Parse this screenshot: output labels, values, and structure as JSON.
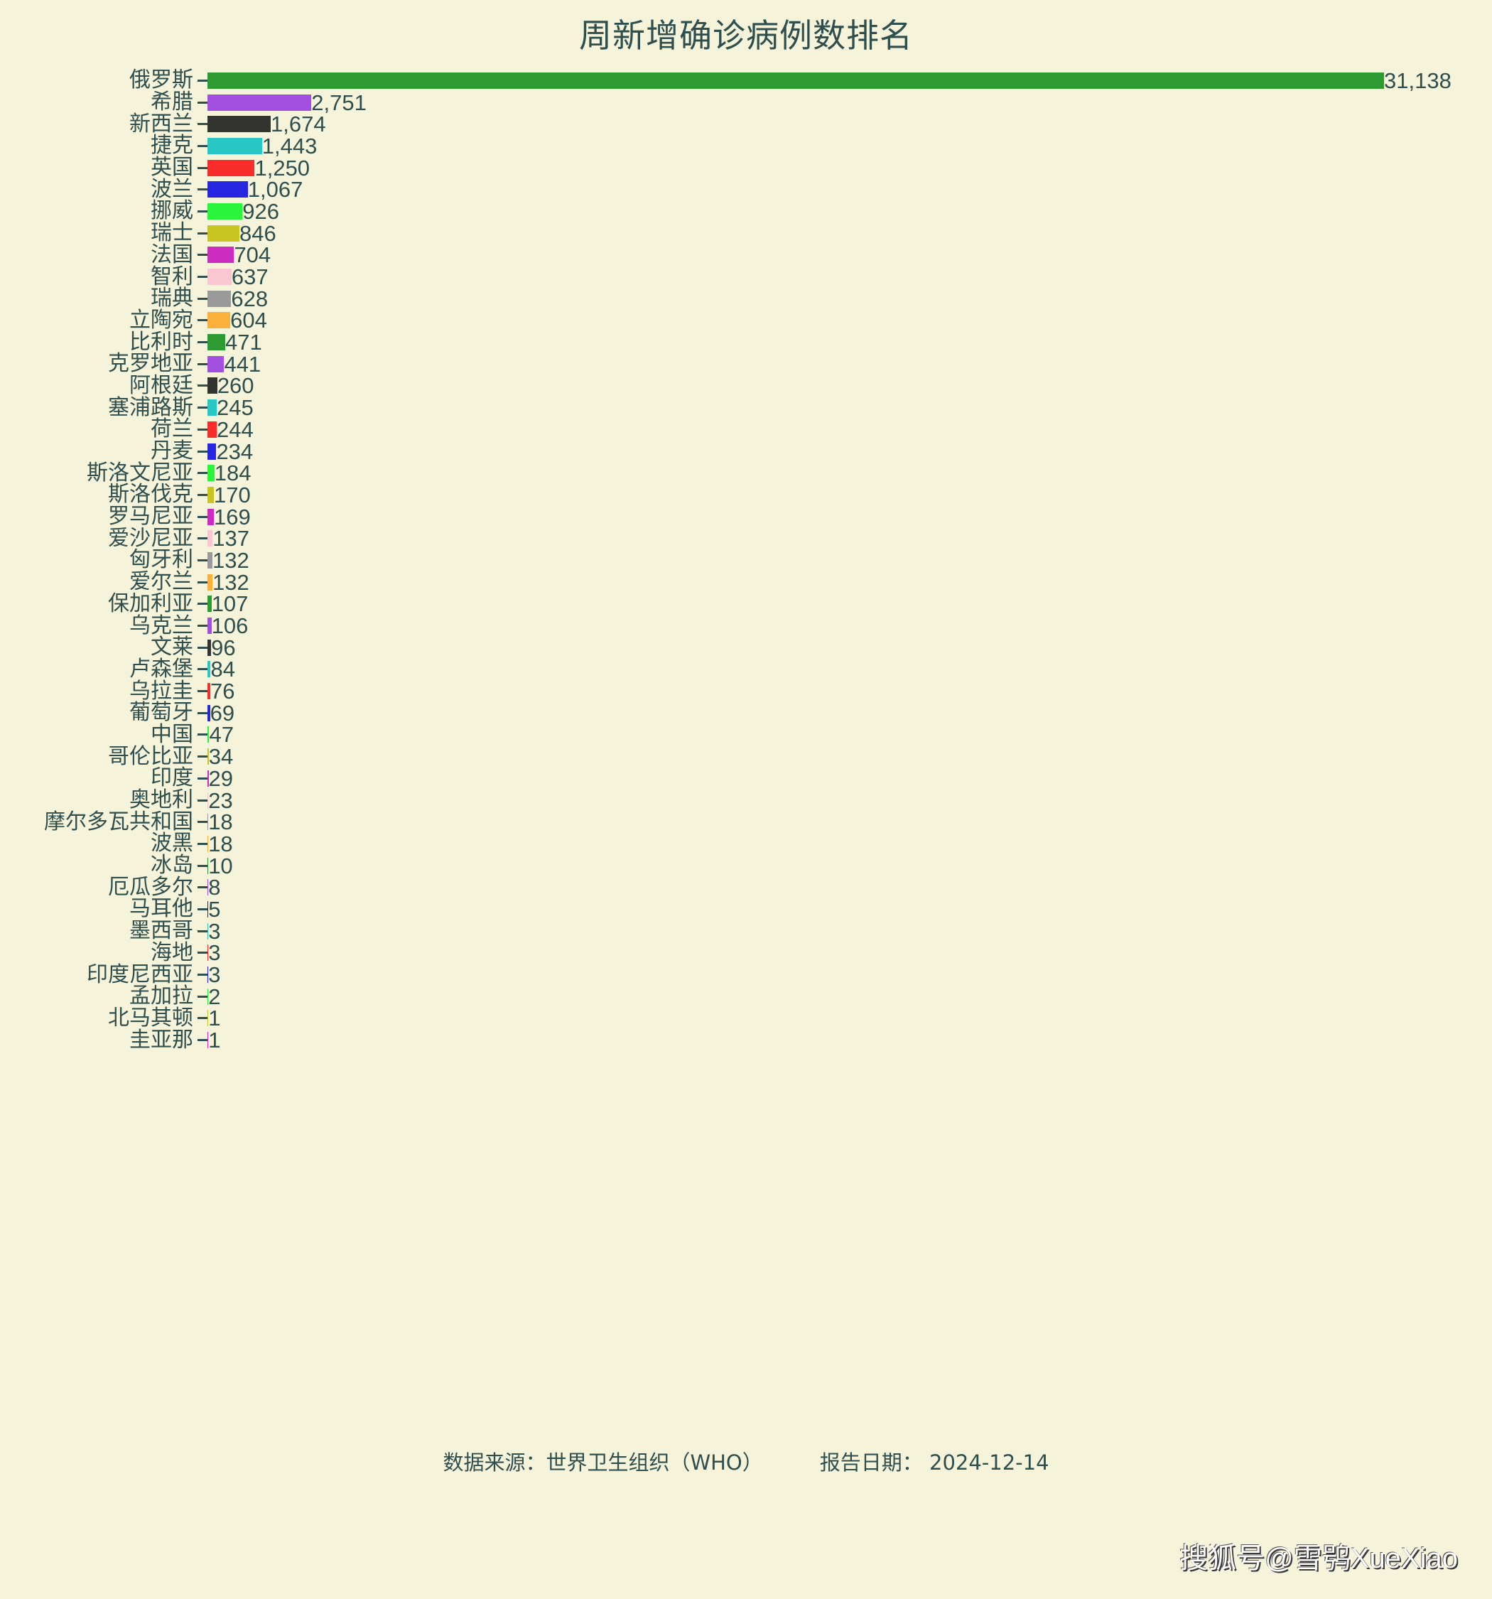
{
  "chart_data": {
    "type": "bar",
    "orientation": "horizontal",
    "title": "周新增确诊病例数排名",
    "xlabel": "",
    "ylabel": "",
    "grid": false,
    "legend": false,
    "xlim": [
      0,
      31138
    ],
    "value_format": "comma-separated thousands",
    "categories": [
      "俄罗斯",
      "希腊",
      "新西兰",
      "捷克",
      "英国",
      "波兰",
      "挪威",
      "瑞士",
      "法国",
      "智利",
      "瑞典",
      "立陶宛",
      "比利时",
      "克罗地亚",
      "阿根廷",
      "塞浦路斯",
      "荷兰",
      "丹麦",
      "斯洛文尼亚",
      "斯洛伐克",
      "罗马尼亚",
      "爱沙尼亚",
      "匈牙利",
      "爱尔兰",
      "保加利亚",
      "乌克兰",
      "文莱",
      "卢森堡",
      "乌拉圭",
      "葡萄牙",
      "中国",
      "哥伦比亚",
      "印度",
      "奥地利",
      "摩尔多瓦共和国",
      "波黑",
      "冰岛",
      "厄瓜多尔",
      "马耳他",
      "墨西哥",
      "海地",
      "印度尼西亚",
      "孟加拉",
      "北马其顿",
      "圭亚那"
    ],
    "values": [
      31138,
      2751,
      1674,
      1443,
      1250,
      1067,
      926,
      846,
      704,
      637,
      628,
      604,
      471,
      441,
      260,
      245,
      244,
      234,
      184,
      170,
      169,
      137,
      132,
      132,
      107,
      106,
      96,
      84,
      76,
      69,
      47,
      34,
      29,
      23,
      18,
      18,
      10,
      8,
      5,
      3,
      3,
      3,
      2,
      1,
      1
    ],
    "labels": [
      "31,138",
      "2,751",
      "1,674",
      "1,443",
      "1,250",
      "1,067",
      "926",
      "846",
      "704",
      "637",
      "628",
      "604",
      "471",
      "441",
      "260",
      "245",
      "244",
      "234",
      "184",
      "170",
      "169",
      "137",
      "132",
      "132",
      "107",
      "106",
      "96",
      "84",
      "76",
      "69",
      "47",
      "34",
      "29",
      "23",
      "18",
      "18",
      "10",
      "8",
      "5",
      "3",
      "3",
      "3",
      "2",
      "1",
      "1"
    ],
    "colors": [
      "#2e9b32",
      "#a34fe0",
      "#333330",
      "#29c6c6",
      "#fa2d2d",
      "#2626e0",
      "#2bf53a",
      "#c8c421",
      "#cc2dbf",
      "#fac6d1",
      "#9a9a9a",
      "#fbb03b",
      "#2e9b32",
      "#a34fe0",
      "#333330",
      "#29c6c6",
      "#fa2d2d",
      "#2626e0",
      "#2bf53a",
      "#c8c421",
      "#cc2dbf",
      "#fac6d1",
      "#9a9a9a",
      "#fbb03b",
      "#2e9b32",
      "#a34fe0",
      "#333330",
      "#29c6c6",
      "#fa2d2d",
      "#2626e0",
      "#2bf53a",
      "#c8c421",
      "#cc2dbf",
      "#fac6d1",
      "#9a9a9a",
      "#fbb03b",
      "#2e9b32",
      "#a34fe0",
      "#333330",
      "#29c6c6",
      "#fa2d2d",
      "#2626e0",
      "#2bf53a",
      "#c8c421",
      "#cc2dbf"
    ]
  },
  "footer": {
    "source_label": "数据来源：世界卫生组织（WHO）",
    "report_date_label": "报告日期：",
    "report_date_value": "2024-12-14"
  },
  "watermark": {
    "text": "搜狐号@雪鸮XueXiao"
  },
  "theme": {
    "background": "#f5f3da",
    "text_color": "#2f4f4f"
  }
}
